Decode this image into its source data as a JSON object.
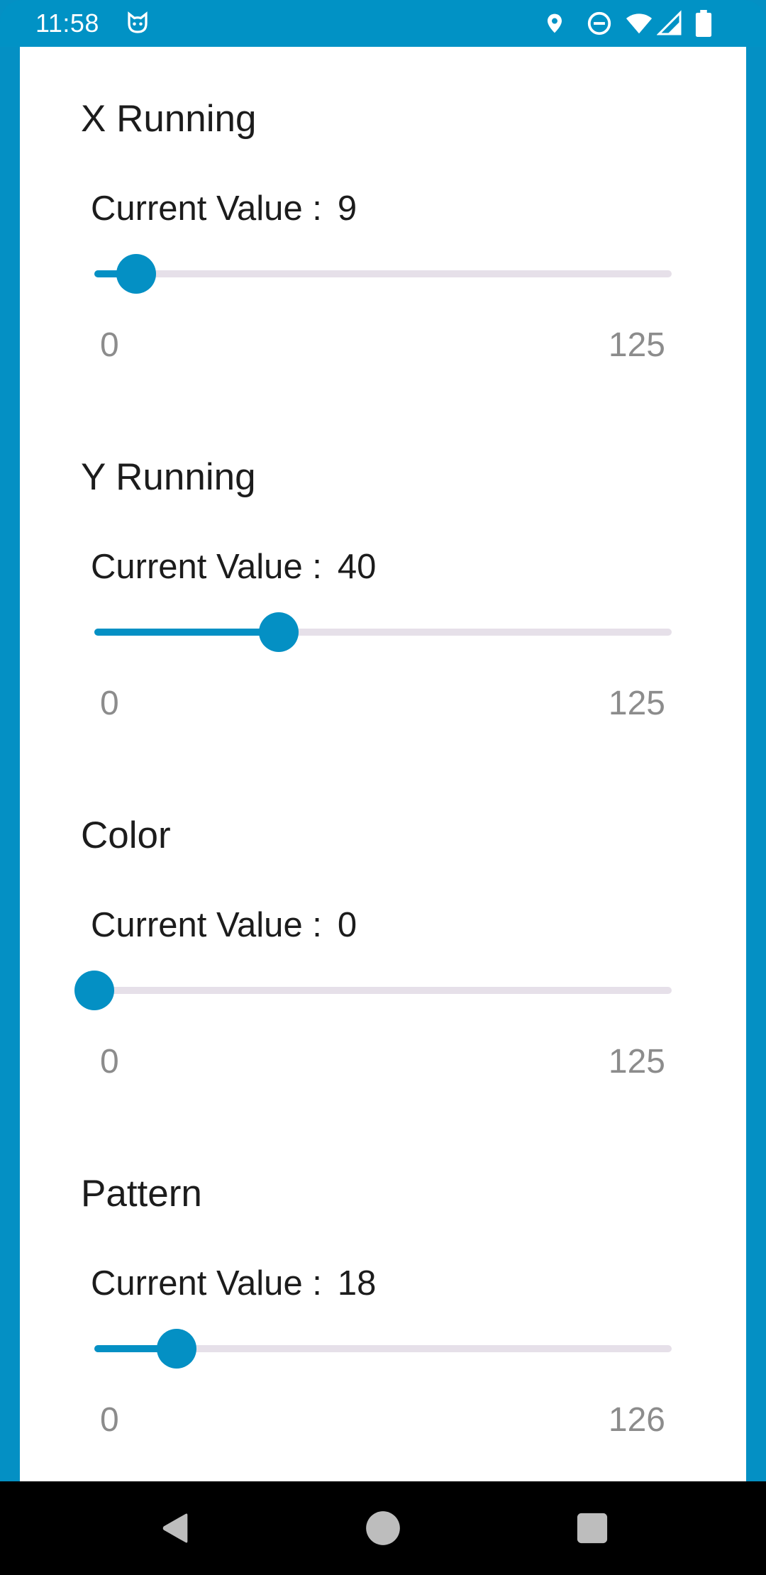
{
  "status_bar": {
    "time": "11:58",
    "icons": [
      "cat-face-icon",
      "location-pin-icon",
      "do-not-disturb-icon",
      "wifi-icon",
      "cell-signal-icon",
      "battery-icon"
    ]
  },
  "sliders": [
    {
      "title": "X Running",
      "current_label": "Current Value :",
      "value": 9,
      "value_text": "9",
      "min": 0,
      "max": 125,
      "min_label": "0",
      "max_label": "125"
    },
    {
      "title": "Y Running",
      "current_label": "Current Value :",
      "value": 40,
      "value_text": "40",
      "min": 0,
      "max": 125,
      "min_label": "0",
      "max_label": "125"
    },
    {
      "title": "Color",
      "current_label": "Current Value :",
      "value": 0,
      "value_text": "0",
      "min": 0,
      "max": 125,
      "min_label": "0",
      "max_label": "125"
    },
    {
      "title": "Pattern",
      "current_label": "Current Value :",
      "value": 18,
      "value_text": "18",
      "min": 0,
      "max": 126,
      "min_label": "0",
      "max_label": "126"
    }
  ],
  "nav_bar": {
    "icons": [
      "back-icon",
      "home-icon",
      "recents-icon"
    ]
  },
  "colors": {
    "accent": "#0490c4",
    "track": "#e6e0e9",
    "range_text": "#8c8c8c",
    "status_bar": "#0192c5"
  }
}
